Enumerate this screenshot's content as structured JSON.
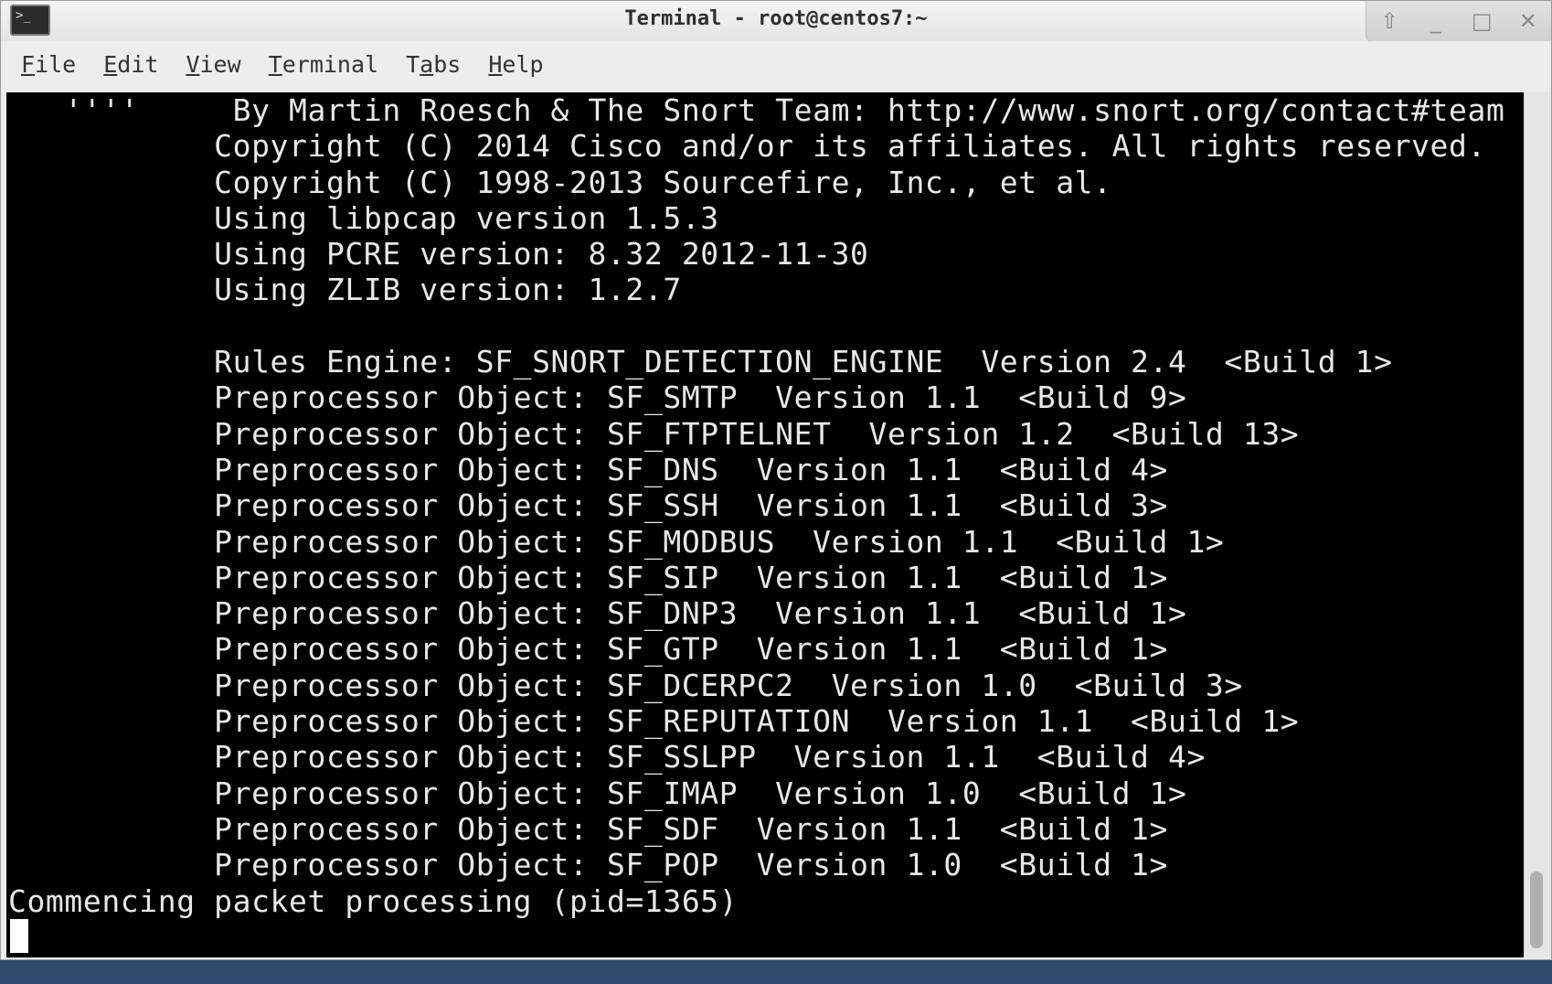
{
  "window": {
    "title": "Terminal - root@centos7:~",
    "icon": "terminal-app-icon",
    "controls": [
      {
        "name": "shade-icon",
        "glyph": "⇧"
      },
      {
        "name": "minimize-icon",
        "glyph": "_"
      },
      {
        "name": "maximize-icon",
        "glyph": "□"
      },
      {
        "name": "close-icon",
        "glyph": "✕"
      }
    ]
  },
  "menubar": {
    "items": [
      {
        "label": "File",
        "mnemonic": "F",
        "rest": "ile"
      },
      {
        "label": "Edit",
        "mnemonic": "E",
        "rest": "dit"
      },
      {
        "label": "View",
        "mnemonic": "V",
        "rest": "iew"
      },
      {
        "label": "Terminal",
        "mnemonic": "T",
        "rest": "erminal"
      },
      {
        "label": "Tabs",
        "mnemonic": "a",
        "before": "T",
        "rest": "bs"
      },
      {
        "label": "Help",
        "mnemonic": "H",
        "rest": "elp"
      }
    ]
  },
  "terminal": {
    "lines": [
      "   ''''     By Martin Roesch & The Snort Team: http://www.snort.org/contact#team",
      "           Copyright (C) 2014 Cisco and/or its affiliates. All rights reserved.",
      "           Copyright (C) 1998-2013 Sourcefire, Inc., et al.",
      "           Using libpcap version 1.5.3",
      "           Using PCRE version: 8.32 2012-11-30",
      "           Using ZLIB version: 1.2.7",
      "",
      "           Rules Engine: SF_SNORT_DETECTION_ENGINE  Version 2.4  <Build 1>",
      "           Preprocessor Object: SF_SMTP  Version 1.1  <Build 9>",
      "           Preprocessor Object: SF_FTPTELNET  Version 1.2  <Build 13>",
      "           Preprocessor Object: SF_DNS  Version 1.1  <Build 4>",
      "           Preprocessor Object: SF_SSH  Version 1.1  <Build 3>",
      "           Preprocessor Object: SF_MODBUS  Version 1.1  <Build 1>",
      "           Preprocessor Object: SF_SIP  Version 1.1  <Build 1>",
      "           Preprocessor Object: SF_DNP3  Version 1.1  <Build 1>",
      "           Preprocessor Object: SF_GTP  Version 1.1  <Build 1>",
      "           Preprocessor Object: SF_DCERPC2  Version 1.0  <Build 3>",
      "           Preprocessor Object: SF_REPUTATION  Version 1.1  <Build 1>",
      "           Preprocessor Object: SF_SSLPP  Version 1.1  <Build 4>",
      "           Preprocessor Object: SF_IMAP  Version 1.0  <Build 1>",
      "           Preprocessor Object: SF_SDF  Version 1.1  <Build 1>",
      "           Preprocessor Object: SF_POP  Version 1.0  <Build 1>",
      "Commencing packet processing (pid=1365)"
    ]
  }
}
